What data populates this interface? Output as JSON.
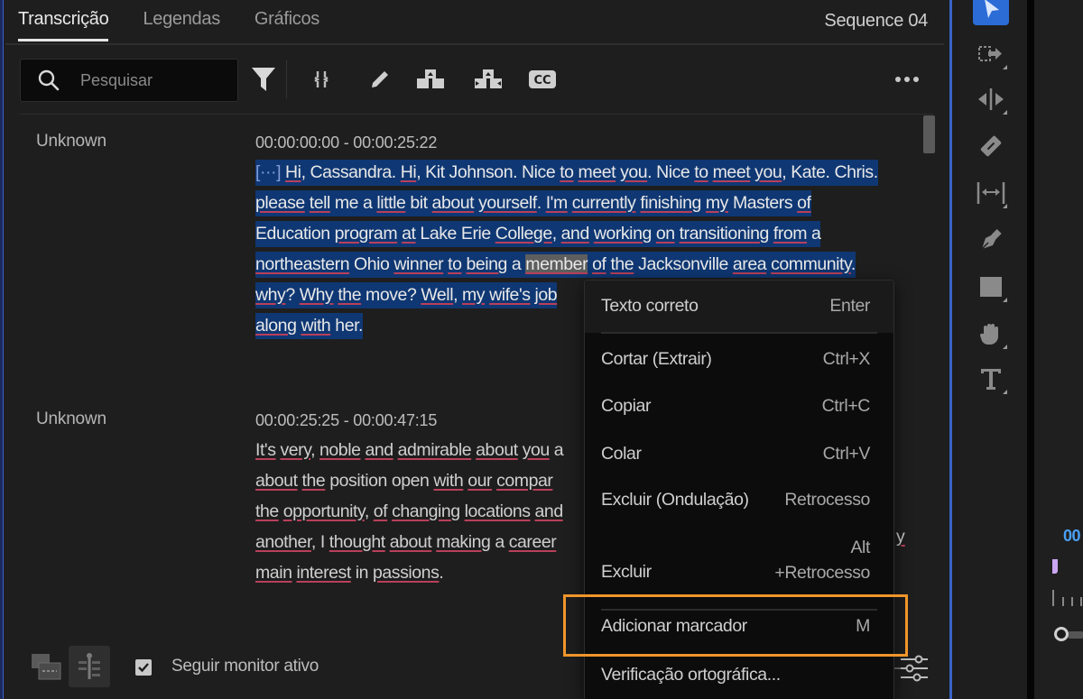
{
  "tabs": [
    {
      "label": "Transcrição",
      "active": true
    },
    {
      "label": "Legendas",
      "active": false
    },
    {
      "label": "Gráficos",
      "active": false
    }
  ],
  "sequence_title": "Sequence 04",
  "toolbar": {
    "search_placeholder": "Pesquisar",
    "icons": [
      "search-icon",
      "filter-icon",
      "merge-segments-icon",
      "edit-pencil-icon",
      "split-segment-icon",
      "ripple-segment-icon",
      "closed-captions-icon",
      "more-options-icon"
    ]
  },
  "segments": [
    {
      "speaker": "Unknown",
      "timecode": "00:00:00:00 - 00:00:25:22",
      "selected": true,
      "lines": [
        "[···] Hi, Cassandra. Hi, Kit Johnson. Nice to meet you. Nice to meet you, Kate. Chris.",
        "please tell me a little bit about yourself. I'm currently finishing my Masters of",
        "Education program at Lake Erie College, and working on transitioning from a",
        "northeastern Ohio winner to being a member of the Jacksonville area community.",
        "why? Why the move? Well, my wife's job",
        "along with her."
      ],
      "highlighted_word": "member"
    },
    {
      "speaker": "Unknown",
      "timecode": "00:00:25:25 - 00:00:47:15",
      "selected": false,
      "lines": [
        "It's very, noble and admirable about you a",
        "about the position open with our compar",
        "the opportunity, of changing locations and",
        "another, I thought about making a career",
        "main interest in passions."
      ],
      "overflow_char": "y"
    }
  ],
  "context_menu": {
    "items": [
      {
        "label": "Texto correto",
        "shortcut": "Enter"
      },
      {
        "label": "Cortar (Extrair)",
        "shortcut": "Ctrl+X"
      },
      {
        "label": "Copiar",
        "shortcut": "Ctrl+C"
      },
      {
        "label": "Colar",
        "shortcut": "Ctrl+V"
      },
      {
        "label": "Excluir (Ondulação)",
        "shortcut": "Retrocesso"
      },
      {
        "label": "Excluir",
        "shortcut_line1": "Alt",
        "shortcut_line2": "+Retrocesso"
      },
      {
        "label": "Adicionar marcador",
        "shortcut": "M",
        "highlighted": true
      },
      {
        "label": "Verificação ortográfica..."
      }
    ]
  },
  "bottom_bar": {
    "follow_monitor_label": "Seguir monitor ativo",
    "follow_monitor_checked": true
  },
  "tools": [
    "selection-tool",
    "track-select-tool",
    "ripple-edit-tool",
    "razor-tool",
    "slip-tool",
    "pen-tool",
    "rectangle-tool",
    "hand-tool",
    "type-tool"
  ],
  "timeline": {
    "timecode_partial": "00"
  },
  "colors": {
    "accent": "#2c6cd6",
    "selection": "#0f3773",
    "highlight_box": "#f0952a",
    "spell_underline": "#b8405a",
    "timecode_blue": "#4aa0f5"
  }
}
